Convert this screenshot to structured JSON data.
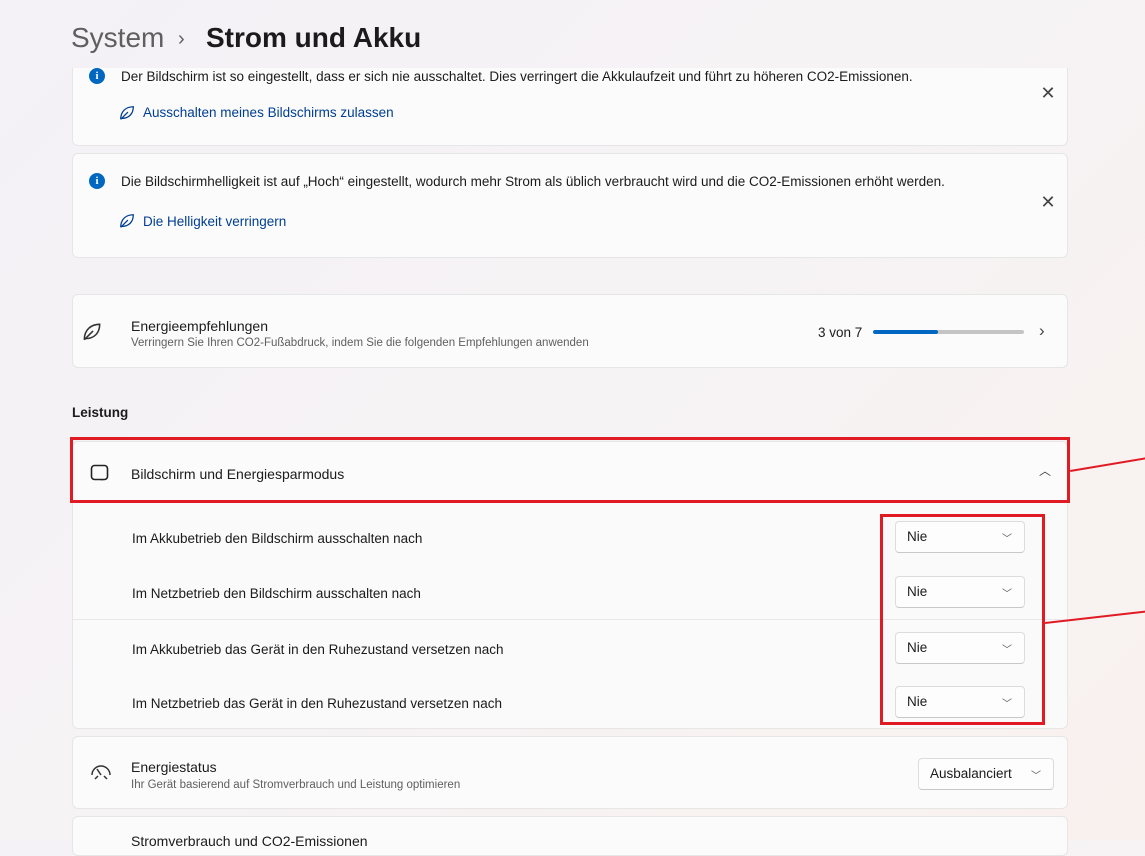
{
  "breadcrumb": {
    "parent": "System",
    "separator": "›",
    "current": "Strom und Akku"
  },
  "notifications": [
    {
      "message": "Der Bildschirm ist so eingestellt, dass er sich nie ausschaltet. Dies verringert die Akkulaufzeit und führt zu höheren CO2-Emissionen.",
      "link": "Ausschalten meines Bildschirms zulassen"
    },
    {
      "message": "Die Bildschirmhelligkeit ist auf „Hoch“ eingestellt, wodurch mehr Strom als üblich verbraucht wird und die CO2-Emissionen erhöht werden.",
      "link": "Die Helligkeit verringern"
    }
  ],
  "energy_recommendations": {
    "title": "Energieempfehlungen",
    "subtitle": "Verringern Sie Ihren CO2-Fußabdruck, indem Sie die folgenden Empfehlungen anwenden",
    "progress_text": "3 von 7",
    "progress_fraction": 0.43
  },
  "section_performance": "Leistung",
  "screen_sleep": {
    "title": "Bildschirm und Energiesparmodus",
    "rows": [
      {
        "label": "Im Akkubetrieb den Bildschirm ausschalten nach",
        "value": "Nie"
      },
      {
        "label": "Im Netzbetrieb den Bildschirm ausschalten nach",
        "value": "Nie"
      },
      {
        "label": "Im Akkubetrieb das Gerät in den Ruhezustand versetzen nach",
        "value": "Nie"
      },
      {
        "label": "Im Netzbetrieb das Gerät in den Ruhezustand versetzen nach",
        "value": "Nie"
      }
    ]
  },
  "power_mode": {
    "title": "Energiestatus",
    "subtitle": "Ihr Gerät basierend auf Stromverbrauch und Leistung optimieren",
    "value": "Ausbalanciert"
  },
  "next_item_title": "Stromverbrauch und CO2-Emissionen",
  "colors": {
    "accent": "#0067c0",
    "annotation": "#e01b24"
  }
}
